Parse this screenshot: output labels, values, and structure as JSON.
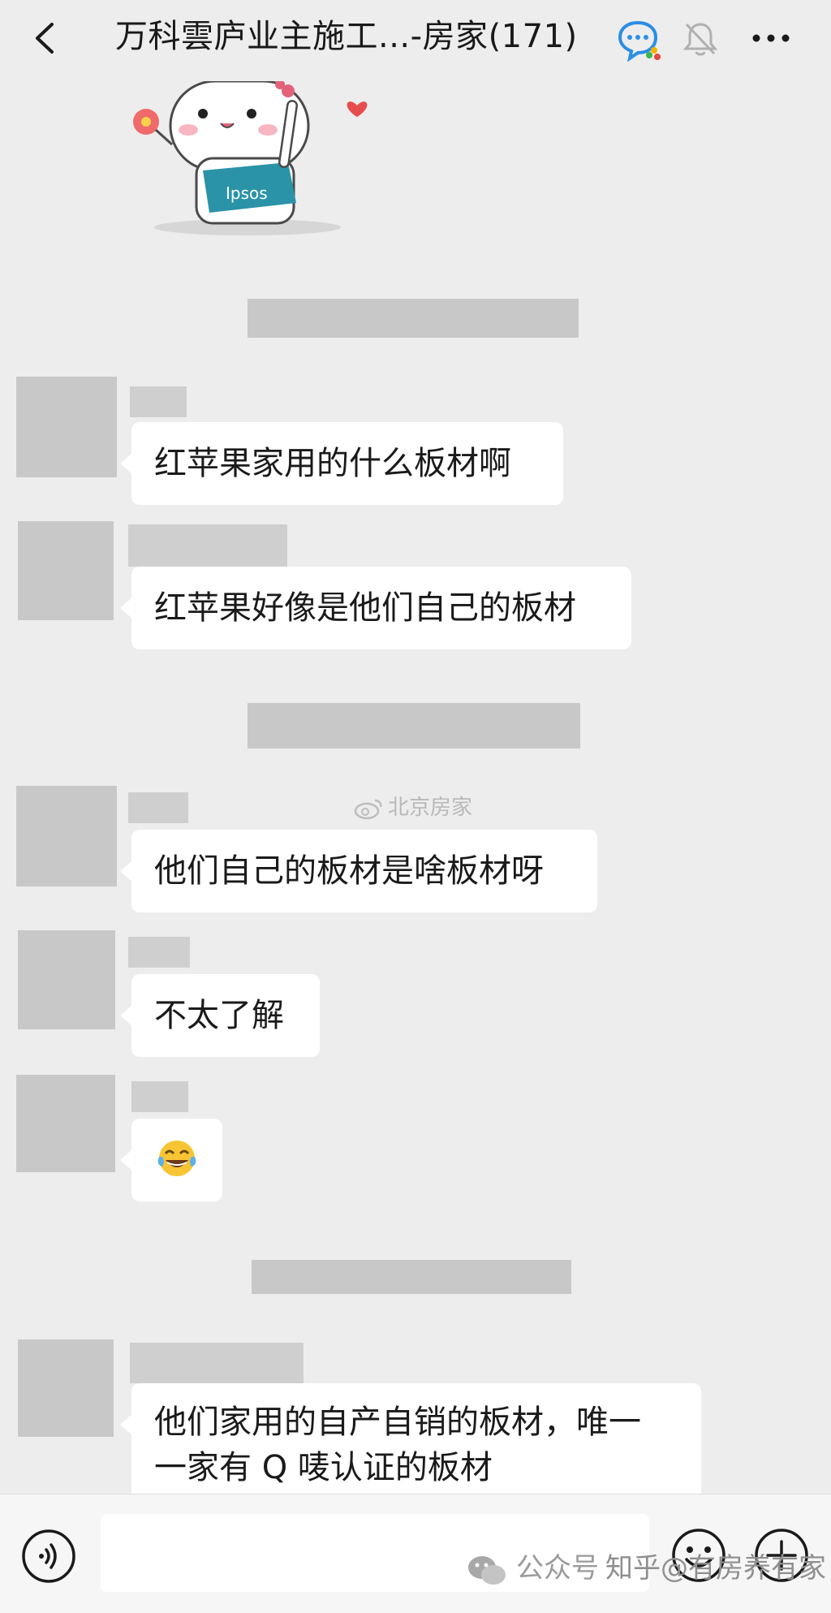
{
  "header": {
    "title": "万科雲庐业主施工...-房家(171)"
  },
  "watermark_center": "北京房家",
  "messages": [
    {
      "text": "红苹果家用的什么板材啊"
    },
    {
      "text": "红苹果好像是他们自己的板材"
    },
    {
      "text": "他们自己的板材是啥板材呀"
    },
    {
      "text": "不太了解"
    },
    {
      "emoji": "😂"
    },
    {
      "text": "他们家用的自产自销的板材，唯一\n一家有 Q 唛认证的板材"
    }
  ],
  "footer_watermark": {
    "left": "公众号",
    "right": "知乎@有房养有家"
  },
  "colors": {
    "background": "#ededed",
    "bubble": "#ffffff",
    "redacted": "#c8c8c8"
  }
}
